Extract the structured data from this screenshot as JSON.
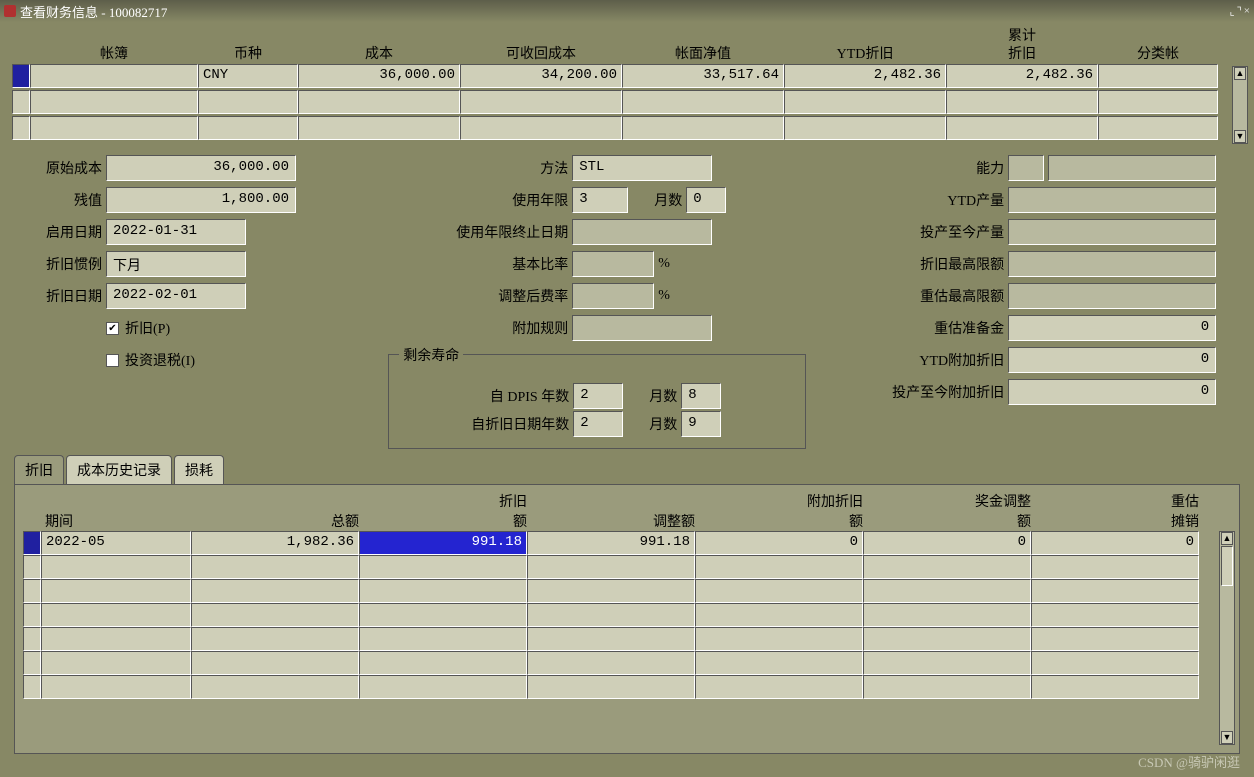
{
  "title": "查看财务信息 - 100082717",
  "watermark": "CSDN @骑驴闲逛",
  "top_headers": {
    "ledger": "帐簿",
    "currency": "币种",
    "cost": "成本",
    "recoverable_cost": "可收回成本",
    "net_book_value": "帐面净值",
    "ytd_depr": "YTD折旧",
    "accum_depr_1": "累计",
    "accum_depr_2": "折旧",
    "category": "分类帐"
  },
  "top_row": {
    "ledger": "",
    "currency": "CNY",
    "cost": "36,000.00",
    "recoverable_cost": "34,200.00",
    "net_book_value": "33,517.64",
    "ytd_depr": "2,482.36",
    "accum_depr": "2,482.36",
    "category": ""
  },
  "left_form": {
    "original_cost_label": "原始成本",
    "original_cost": "36,000.00",
    "salvage_label": "残值",
    "salvage": "1,800.00",
    "enable_date_label": "启用日期",
    "enable_date": "2022-01-31",
    "depr_conv_label": "折旧惯例",
    "depr_conv": "下月",
    "depr_date_label": "折旧日期",
    "depr_date": "2022-02-01",
    "depr_cb_label": "折旧(P)",
    "itc_cb_label": "投资退税(I)"
  },
  "mid_form": {
    "method_label": "方法",
    "method": "STL",
    "life_years_label": "使用年限",
    "life_years": "3",
    "months_label": "月数",
    "life_months": "0",
    "life_end_label": "使用年限终止日期",
    "basic_rate_label": "基本比率",
    "pct": "%",
    "adj_rate_label": "调整后费率",
    "addl_rule_label": "附加规则",
    "remaining_life_title": "剩余寿命",
    "dpis_years_label": "自 DPIS 年数",
    "dpis_years": "2",
    "dpis_months": "8",
    "depr_years_label": "自折旧日期年数",
    "depr_years": "2",
    "depr_months": "9"
  },
  "right_form": {
    "capacity_label": "能力",
    "ytd_prod_label": "YTD产量",
    "ltd_prod_label": "投产至今产量",
    "depr_limit_label": "折旧最高限额",
    "reval_limit_label": "重估最高限额",
    "reval_reserve_label": "重估准备金",
    "reval_reserve": "0",
    "ytd_bonus_label": "YTD附加折旧",
    "ytd_bonus": "0",
    "ltd_bonus_label": "投产至今附加折旧",
    "ltd_bonus": "0"
  },
  "tabs": {
    "depr": "折旧",
    "cost_history": "成本历史记录",
    "impairment": "损耗"
  },
  "table": {
    "headers": {
      "period": "期间",
      "total": "总额",
      "depr_1": "折旧",
      "depr_2": "额",
      "adj": "调整额",
      "bonus_1": "附加折旧",
      "bonus_2": "额",
      "bonus_adj_1": "奖金调整",
      "bonus_adj_2": "额",
      "reval_1": "重估",
      "reval_2": "摊销"
    },
    "rows": [
      {
        "period": "2022-05",
        "total": "1,982.36",
        "depr": "991.18",
        "adj": "991.18",
        "bonus": "0",
        "bonus_adj": "0",
        "reval": "0"
      }
    ]
  }
}
